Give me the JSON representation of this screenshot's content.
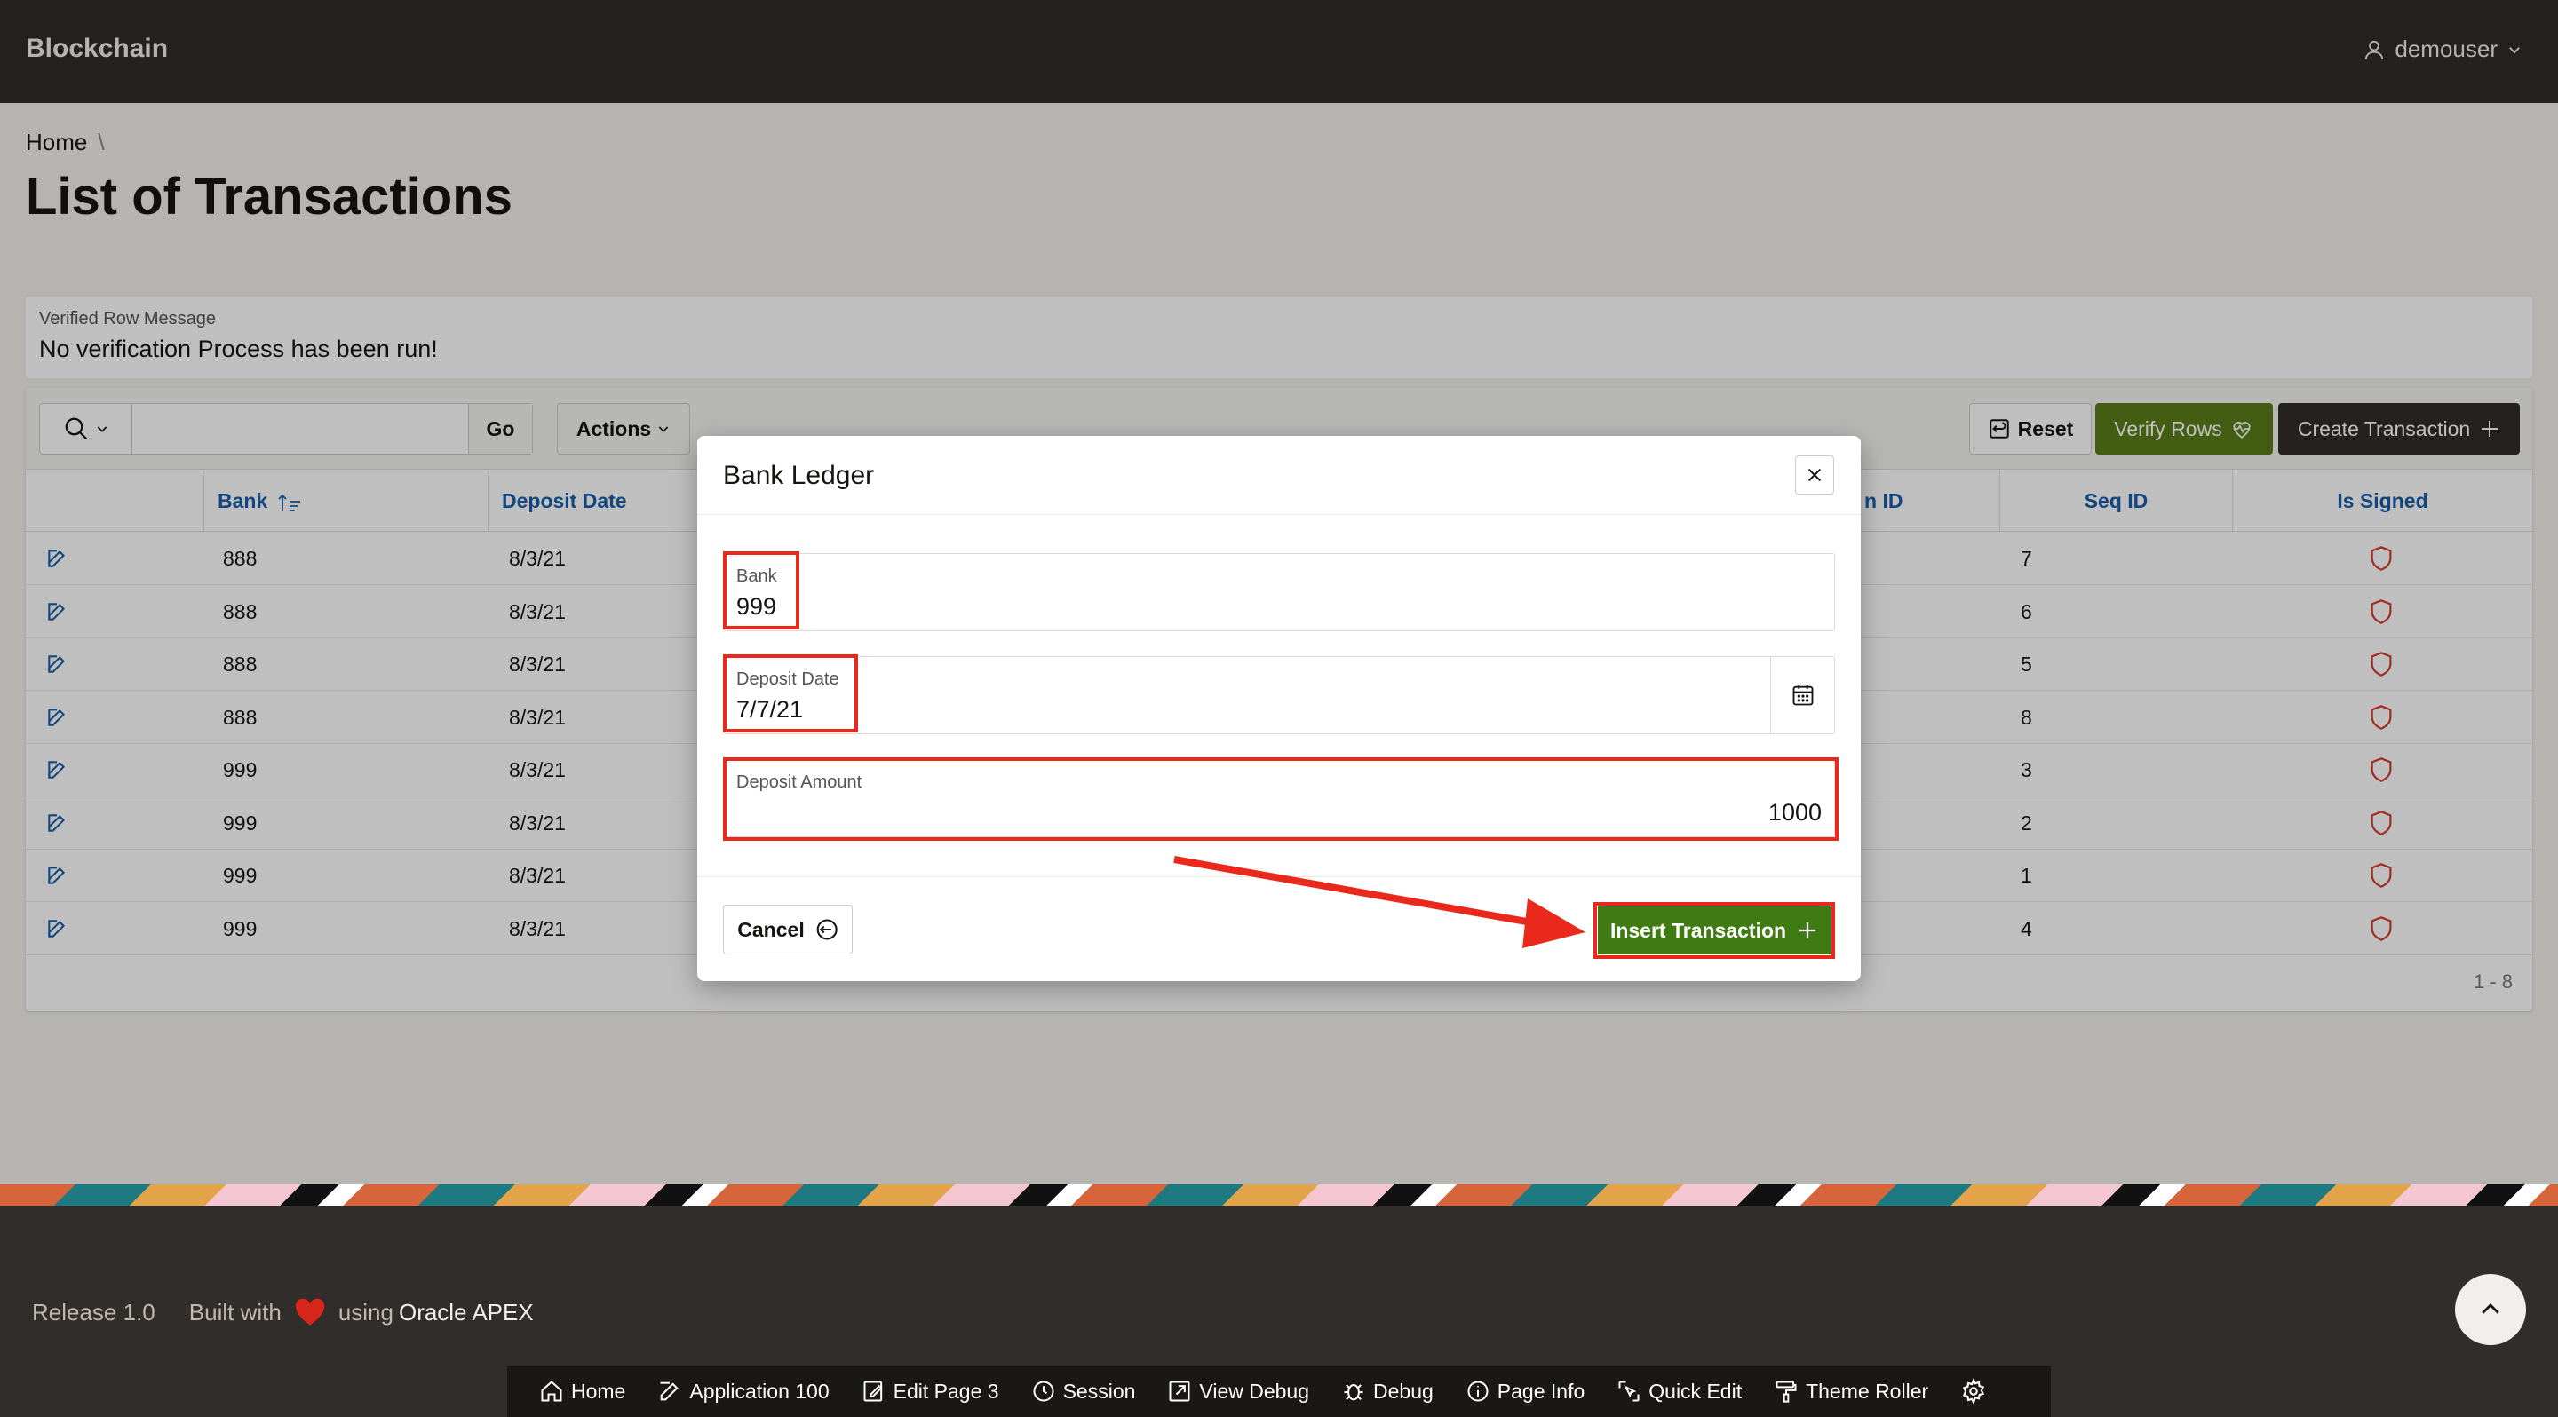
{
  "header": {
    "app_title": "Blockchain",
    "user": "demouser"
  },
  "breadcrumb": {
    "home": "Home"
  },
  "page_title": "List of Transactions",
  "verify_region": {
    "label": "Verified Row Message",
    "message": "No verification Process has been run!"
  },
  "toolbar": {
    "go_label": "Go",
    "actions_label": "Actions",
    "reset_label": "Reset",
    "verify_rows_label": "Verify Rows",
    "create_label": "Create Transaction"
  },
  "table": {
    "columns": [
      "Bank",
      "Deposit Date",
      "n ID",
      "Seq ID",
      "Is Signed"
    ],
    "rows": [
      {
        "bank": "888",
        "date": "8/3/21",
        "seq": "7"
      },
      {
        "bank": "888",
        "date": "8/3/21",
        "seq": "6"
      },
      {
        "bank": "888",
        "date": "8/3/21",
        "seq": "5"
      },
      {
        "bank": "888",
        "date": "8/3/21",
        "seq": "8"
      },
      {
        "bank": "999",
        "date": "8/3/21",
        "seq": "3"
      },
      {
        "bank": "999",
        "date": "8/3/21",
        "seq": "2"
      },
      {
        "bank": "999",
        "date": "8/3/21",
        "seq": "1"
      },
      {
        "bank": "999",
        "date": "8/3/21",
        "seq": "4"
      }
    ],
    "pager": "1 - 8"
  },
  "dialog": {
    "title": "Bank Ledger",
    "bank_label": "Bank",
    "bank_value": "999",
    "date_label": "Deposit Date",
    "date_value": "7/7/21",
    "amount_label": "Deposit Amount",
    "amount_value": "1000",
    "cancel_label": "Cancel",
    "insert_label": "Insert Transaction"
  },
  "footer": {
    "release": "Release 1.0",
    "built_with": "Built with",
    "using": "using",
    "apex": "Oracle APEX"
  },
  "devbar": [
    "Home",
    "Application 100",
    "Edit Page 3",
    "Session",
    "View Debug",
    "Debug",
    "Page Info",
    "Quick Edit",
    "Theme Roller"
  ],
  "colors": {
    "header": "#312d2a",
    "verify_green": "#5a7d1a",
    "insert_green": "#3f7a12",
    "highlight_red": "#e8291c",
    "link_blue": "#1a5ea8",
    "shield_red": "#d23b2e"
  }
}
